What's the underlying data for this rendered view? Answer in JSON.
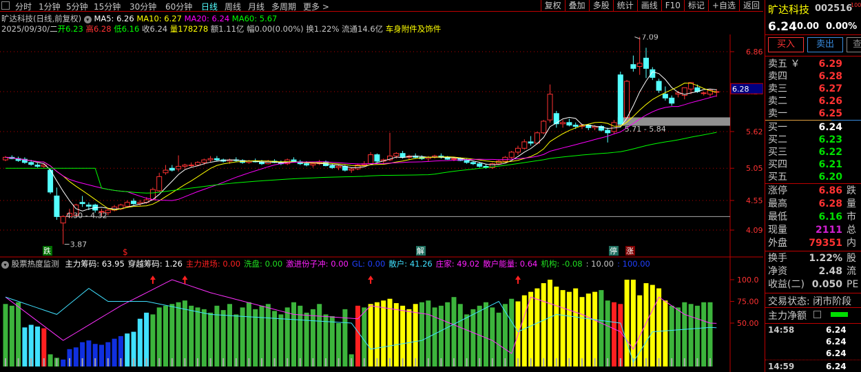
{
  "toolbar": {
    "periods": [
      "分时",
      "1分钟",
      "5分钟",
      "15分钟",
      "30分钟",
      "60分钟",
      "日线",
      "周线",
      "月线",
      "多周期",
      "更多 >"
    ],
    "active_period": "日线",
    "right_buttons": [
      "复权",
      "叠加",
      "多股",
      "统计",
      "画线",
      "F10",
      "标记",
      "+自选",
      "返回"
    ]
  },
  "info": {
    "title": "旷达科技(日线,前复权)",
    "ma5": "MA5: 6.26",
    "ma10": "MA10: 6.27",
    "ma20": "MA20: 6.24",
    "ma60": "MA60: 5.67",
    "date": "2025/09/30/二",
    "open_l": "开",
    "open": "6.23",
    "high_l": "高",
    "high": "6.28",
    "low_l": "低",
    "low": "6.16",
    "close": "收6.24",
    "vol_l": "量",
    "vol": "178278",
    "amount": "额1.11亿",
    "range": "幅0.00(0.00%)",
    "turnover": "换1.22%",
    "float": "流通14.6亿",
    "sector": "车身附件及饰件"
  },
  "axis": {
    "labels": [
      "6.86",
      "6.24",
      "5.62",
      "5.05",
      "4.55",
      "4.09"
    ],
    "levels": [
      6.86,
      6.24,
      5.62,
      5.05,
      4.55,
      4.09
    ],
    "current_price_tag": "6.28"
  },
  "annotations": {
    "high": "7.09",
    "low": "3.87",
    "range_low": "4.30 - 4.32",
    "range_high": "5.71 - 5.84"
  },
  "signals": {
    "die": "跌",
    "dollar": "$",
    "jie": "解",
    "ting": "停",
    "zhang": "涨"
  },
  "indicator": {
    "name": "股票热度监测",
    "items": [
      {
        "label": "主力筹码: 63.95",
        "color": "#ffffff"
      },
      {
        "label": "穿越筹码: 1.26",
        "color": "#ffffff"
      },
      {
        "label": "主力进场: 0.00",
        "color": "#ff2020"
      },
      {
        "label": "洗盘: 0.00",
        "color": "#20e020"
      },
      {
        "label": "激进份子冲: 0.00",
        "color": "#ff20ff"
      },
      {
        "label": "GL: 0.00",
        "color": "#2040ff"
      },
      {
        "label": "散户: 41.26",
        "color": "#40e0ff"
      },
      {
        "label": "庄家: 49.02",
        "color": "#ff20ff"
      },
      {
        "label": "散户能量: 0.64",
        "color": "#ff20ff"
      },
      {
        "label": "机构: -0.08",
        "color": "#20e020"
      },
      {
        "label": ": 10.00",
        "color": "#c8c8c8"
      },
      {
        "label": ": 100.00",
        "color": "#2040ff"
      }
    ],
    "axis_labels": [
      "100.0",
      "75.00",
      "50.00"
    ]
  },
  "colors": {
    "up": "#ff3232",
    "down": "#54ffff",
    "ma5": "#ffffff",
    "ma10": "#ffff00",
    "ma20": "#ff00ff",
    "ma60": "#00ff00",
    "grid": "#c00000"
  },
  "chart_data": {
    "type": "candlestick",
    "ohlc": [
      [
        5.18,
        5.24,
        5.16,
        5.22
      ],
      [
        5.22,
        5.25,
        5.19,
        5.2
      ],
      [
        5.2,
        5.23,
        5.15,
        5.17
      ],
      [
        5.19,
        5.22,
        5.12,
        5.14
      ],
      [
        5.14,
        5.18,
        5.09,
        5.11
      ],
      [
        5.1,
        5.13,
        5.06,
        5.08
      ],
      [
        5.08,
        5.12,
        5.05,
        5.1
      ],
      [
        5.02,
        5.04,
        4.65,
        4.68
      ],
      [
        4.62,
        4.75,
        4.25,
        4.3
      ],
      [
        4.2,
        4.32,
        3.87,
        4.3
      ],
      [
        4.3,
        4.42,
        4.28,
        4.35
      ],
      [
        4.32,
        4.5,
        4.3,
        4.48
      ],
      [
        4.52,
        4.62,
        4.45,
        4.5
      ],
      [
        4.48,
        4.52,
        4.4,
        4.46
      ],
      [
        4.48,
        4.5,
        4.36,
        4.4
      ],
      [
        4.38,
        4.42,
        4.3,
        4.38
      ],
      [
        4.36,
        4.44,
        4.32,
        4.4
      ],
      [
        4.4,
        4.48,
        4.38,
        4.45
      ],
      [
        4.42,
        4.5,
        4.4,
        4.48
      ],
      [
        4.46,
        4.55,
        4.44,
        4.52
      ],
      [
        4.54,
        4.58,
        4.48,
        4.5
      ],
      [
        4.5,
        4.56,
        4.46,
        4.52
      ],
      [
        4.52,
        4.6,
        4.5,
        4.56
      ],
      [
        4.56,
        4.75,
        4.55,
        4.72
      ],
      [
        4.7,
        4.98,
        4.68,
        4.92
      ],
      [
        4.98,
        5.1,
        4.95,
        5.02
      ],
      [
        5.05,
        5.1,
        5.0,
        5.02
      ],
      [
        5.04,
        5.25,
        5.0,
        5.08
      ],
      [
        5.08,
        5.12,
        5.04,
        5.1
      ],
      [
        5.1,
        5.14,
        5.06,
        5.1
      ],
      [
        5.1,
        5.16,
        5.08,
        5.14
      ],
      [
        5.14,
        5.2,
        5.1,
        5.18
      ],
      [
        5.18,
        5.24,
        5.14,
        5.2
      ],
      [
        5.2,
        5.24,
        5.16,
        5.18
      ],
      [
        5.18,
        5.2,
        5.14,
        5.16
      ],
      [
        5.16,
        5.2,
        5.12,
        5.18
      ],
      [
        5.18,
        5.22,
        5.15,
        5.17
      ],
      [
        5.17,
        5.19,
        5.12,
        5.14
      ],
      [
        5.14,
        5.18,
        5.12,
        5.16
      ],
      [
        5.16,
        5.2,
        5.14,
        5.15
      ],
      [
        5.15,
        5.18,
        5.1,
        5.12
      ],
      [
        5.12,
        5.18,
        5.11,
        5.16
      ],
      [
        5.16,
        5.19,
        5.13,
        5.14
      ],
      [
        5.14,
        5.17,
        5.1,
        5.12
      ],
      [
        5.12,
        5.2,
        5.1,
        5.18
      ],
      [
        5.18,
        5.22,
        5.14,
        5.15
      ],
      [
        5.15,
        5.18,
        5.1,
        5.12
      ],
      [
        5.12,
        5.16,
        5.08,
        5.1
      ],
      [
        5.1,
        5.14,
        5.06,
        5.12
      ],
      [
        5.12,
        5.18,
        5.1,
        5.15
      ],
      [
        5.15,
        5.17,
        5.08,
        5.09
      ],
      [
        5.09,
        5.12,
        5.04,
        5.06
      ],
      [
        5.06,
        5.1,
        5.02,
        5.08
      ],
      [
        5.08,
        5.1,
        5.0,
        5.02
      ],
      [
        5.02,
        5.06,
        4.98,
        5.04
      ],
      [
        5.04,
        5.12,
        5.02,
        5.1
      ],
      [
        5.1,
        5.16,
        5.08,
        5.12
      ],
      [
        5.12,
        5.3,
        5.1,
        5.26
      ],
      [
        5.26,
        5.28,
        5.14,
        5.16
      ],
      [
        5.16,
        5.2,
        5.12,
        5.18
      ],
      [
        5.18,
        5.6,
        5.16,
        5.24
      ],
      [
        5.24,
        5.3,
        5.2,
        5.28
      ],
      [
        5.28,
        5.32,
        5.2,
        5.22
      ],
      [
        5.22,
        5.26,
        5.18,
        5.24
      ],
      [
        5.24,
        5.28,
        5.2,
        5.22
      ],
      [
        5.22,
        5.25,
        5.18,
        5.2
      ],
      [
        5.2,
        5.24,
        5.16,
        5.22
      ],
      [
        5.22,
        5.26,
        5.2,
        5.24
      ],
      [
        5.24,
        5.28,
        5.2,
        5.22
      ],
      [
        5.22,
        5.24,
        5.18,
        5.19
      ],
      [
        5.19,
        5.22,
        5.16,
        5.2
      ],
      [
        5.2,
        5.22,
        5.16,
        5.17
      ],
      [
        5.17,
        5.2,
        5.12,
        5.14
      ],
      [
        5.14,
        5.16,
        5.1,
        5.12
      ],
      [
        5.12,
        5.14,
        5.06,
        5.08
      ],
      [
        5.08,
        5.12,
        5.04,
        5.06
      ],
      [
        5.06,
        5.14,
        5.04,
        5.12
      ],
      [
        5.12,
        5.18,
        5.1,
        5.16
      ],
      [
        5.16,
        5.24,
        5.14,
        5.22
      ],
      [
        5.22,
        5.32,
        5.2,
        5.3
      ],
      [
        5.3,
        5.4,
        5.26,
        5.36
      ],
      [
        5.36,
        5.5,
        5.34,
        5.46
      ],
      [
        5.46,
        5.55,
        5.4,
        5.44
      ],
      [
        5.44,
        5.62,
        5.42,
        5.6
      ],
      [
        5.6,
        5.8,
        5.58,
        5.78
      ],
      [
        5.8,
        6.35,
        5.76,
        6.2
      ],
      [
        5.9,
        5.94,
        5.68,
        5.74
      ],
      [
        5.74,
        5.8,
        5.68,
        5.76
      ],
      [
        5.76,
        5.82,
        5.7,
        5.72
      ],
      [
        5.72,
        5.76,
        5.66,
        5.7
      ],
      [
        5.7,
        5.74,
        5.66,
        5.72
      ],
      [
        5.72,
        5.74,
        5.64,
        5.68
      ],
      [
        5.68,
        5.72,
        5.64,
        5.7
      ],
      [
        5.7,
        5.72,
        5.62,
        5.64
      ],
      [
        5.64,
        5.68,
        5.45,
        5.6
      ],
      [
        5.62,
        5.8,
        5.58,
        5.76
      ],
      [
        6.5,
        6.55,
        5.72,
        5.74
      ],
      [
        5.84,
        6.42,
        5.8,
        6.4
      ],
      [
        6.66,
        6.8,
        6.55,
        6.6
      ],
      [
        6.63,
        7.09,
        6.5,
        6.68
      ],
      [
        6.76,
        6.92,
        6.45,
        6.6
      ],
      [
        6.58,
        6.62,
        6.42,
        6.46
      ],
      [
        6.4,
        6.44,
        6.22,
        6.26
      ],
      [
        6.2,
        6.32,
        6.1,
        6.14
      ],
      [
        6.14,
        6.18,
        6.02,
        6.06
      ],
      [
        6.2,
        6.25,
        6.15,
        6.22
      ],
      [
        6.18,
        6.3,
        6.12,
        6.3
      ],
      [
        6.28,
        6.38,
        6.2,
        6.38
      ],
      [
        6.3,
        6.35,
        6.22,
        6.24
      ],
      [
        6.22,
        6.24,
        6.18,
        6.22
      ],
      [
        6.2,
        6.28,
        6.16,
        6.26
      ],
      [
        6.23,
        6.28,
        6.16,
        6.24
      ]
    ],
    "ylim": [
      3.8,
      7.2
    ],
    "indicator_bars": [
      72,
      70,
      74,
      45,
      48,
      46,
      44,
      14,
      10,
      8,
      20,
      22,
      28,
      30,
      26,
      25,
      28,
      32,
      35,
      38,
      40,
      55,
      62,
      60,
      68,
      70,
      72,
      74,
      76,
      70,
      68,
      66,
      62,
      70,
      65,
      72,
      60,
      68,
      74,
      66,
      70,
      72,
      64,
      60,
      68,
      74,
      70,
      62,
      66,
      72,
      60,
      58,
      50,
      66,
      14,
      70,
      68,
      72,
      74,
      76,
      78,
      73,
      70,
      66,
      72,
      74,
      76,
      68,
      70,
      74,
      80,
      72,
      60,
      66,
      70,
      74,
      68,
      62,
      72,
      78,
      75,
      82,
      86,
      90,
      96,
      100,
      92,
      88,
      86,
      90,
      80,
      84,
      86,
      88,
      76,
      74,
      72,
      100,
      100,
      82,
      96,
      94,
      90,
      76,
      70,
      68,
      74,
      72,
      70,
      74,
      74
    ],
    "indicator_bar_types": "gggcccrggbbbbbbbbbbccccggggggggggggggggggggggggggggggggrgyyyyyyyygggggggggggggggyyyyyyyyyyyyyggrryyyyyyyggggggg",
    "line_main_keyframes": [
      [
        0,
        80
      ],
      [
        9,
        30
      ],
      [
        18,
        70
      ],
      [
        26,
        100
      ],
      [
        32,
        85
      ],
      [
        45,
        60
      ],
      [
        55,
        55
      ],
      [
        57,
        70
      ],
      [
        66,
        60
      ],
      [
        76,
        30
      ],
      [
        79,
        15
      ],
      [
        82,
        80
      ],
      [
        90,
        60
      ],
      [
        96,
        40
      ],
      [
        98,
        20
      ],
      [
        102,
        80
      ],
      [
        106,
        60
      ],
      [
        110,
        50
      ]
    ],
    "line_retail_keyframes": [
      [
        0,
        80
      ],
      [
        8,
        60
      ],
      [
        13,
        90
      ],
      [
        16,
        75
      ],
      [
        22,
        75
      ],
      [
        32,
        60
      ],
      [
        54,
        50
      ],
      [
        57,
        20
      ],
      [
        65,
        30
      ],
      [
        77,
        75
      ],
      [
        80,
        40
      ],
      [
        86,
        60
      ],
      [
        96,
        50
      ],
      [
        98,
        5
      ],
      [
        101,
        40
      ],
      [
        110,
        45
      ]
    ],
    "arrow_indices": [
      23,
      28,
      57,
      80
    ]
  },
  "quote": {
    "name": "旷达科技",
    "code": "002516",
    "flag": "1000",
    "price": "6.24",
    "change": "0.00",
    "pct": "0.00%",
    "buy_btn": "买入",
    "sell_btn": "卖出",
    "more_btn": "查",
    "asks": [
      {
        "l": "卖五 ￥",
        "v": "6.29"
      },
      {
        "l": "卖四",
        "v": "6.28"
      },
      {
        "l": "卖三",
        "v": "6.27"
      },
      {
        "l": "卖二",
        "v": "6.26"
      },
      {
        "l": "卖一",
        "v": "6.25"
      }
    ],
    "bids": [
      {
        "l": "买一",
        "v": "6.24"
      },
      {
        "l": "买二",
        "v": "6.23"
      },
      {
        "l": "买三",
        "v": "6.22"
      },
      {
        "l": "买四",
        "v": "6.21"
      },
      {
        "l": "买五",
        "v": "6.20"
      }
    ],
    "stats1": [
      {
        "l": "涨停",
        "v": "6.86",
        "x": "跌"
      },
      {
        "l": "最高",
        "v": "6.28",
        "x": "量"
      },
      {
        "l": "最低",
        "v": "6.16",
        "x": "市"
      },
      {
        "l": "现量",
        "v": "2111",
        "x": "总"
      },
      {
        "l": "外盘",
        "v": "79351",
        "x": "内"
      }
    ],
    "stats2": [
      {
        "l": "换手",
        "v": "1.22%",
        "x": "股"
      },
      {
        "l": "净资",
        "v": "2.48",
        "x": "流"
      },
      {
        "l": "收益(二)",
        "v": "0.050",
        "x": "PE"
      }
    ],
    "status": "交易状态: 闭市阶段",
    "net_label": "主力净额",
    "ticks": [
      {
        "t": "14:58",
        "p": "6.24"
      },
      {
        "t": "",
        "p": "6.24"
      },
      {
        "t": "",
        "p": "6.24"
      },
      {
        "t": "14:59",
        "p": "6.24"
      }
    ]
  }
}
